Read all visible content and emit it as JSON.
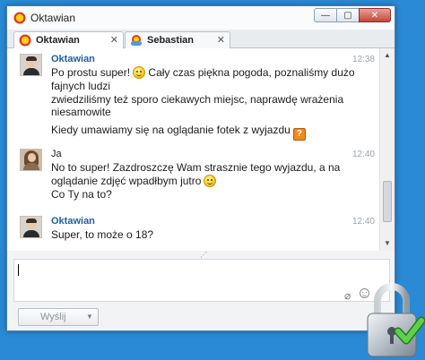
{
  "window": {
    "title": "Oktawian",
    "controls": {
      "minimize": "—",
      "maximize": "▢",
      "close": "✕"
    }
  },
  "tabs": [
    {
      "label": "Oktawian",
      "active": true,
      "close": "✕"
    },
    {
      "label": "Sebastian",
      "active": false,
      "close": "✕"
    }
  ],
  "messages": [
    {
      "sender": "Oktawian",
      "time": "12:38",
      "lines": [
        "Po prostu super!",
        "Cały czas piękna pogoda, poznaliśmy dużo",
        "fajnych ludzi",
        "zwiedziliśmy też sporo ciekawych miejsc, naprawdę wrażenia",
        "niesamowite",
        "Kiedy umawiamy się na oglądanie fotek z wyjazdu"
      ]
    },
    {
      "sender": "Ja",
      "time": "12:40",
      "lines": [
        "No to super! Zazdroszczę Wam strasznie tego wyjazdu, a na",
        "oglądanie zdjęć wpadłbym jutro",
        "Co Ty na to?"
      ]
    },
    {
      "sender": "Oktawian",
      "time": "12:40",
      "lines": [
        "Super, to może o 18?"
      ]
    }
  ],
  "scrollbar": {
    "up": "▲",
    "down": "▼"
  },
  "resize_grip": "⋰",
  "input": {
    "value": ""
  },
  "send_button": {
    "label": "Wyślij",
    "dropdown": "▼"
  },
  "icons": [
    "sun-icon",
    "sun-cloud-icon",
    "smiley-emoji-icon",
    "question-emoji-icon",
    "attach-icon",
    "smiley-icon",
    "padlock-icon"
  ]
}
